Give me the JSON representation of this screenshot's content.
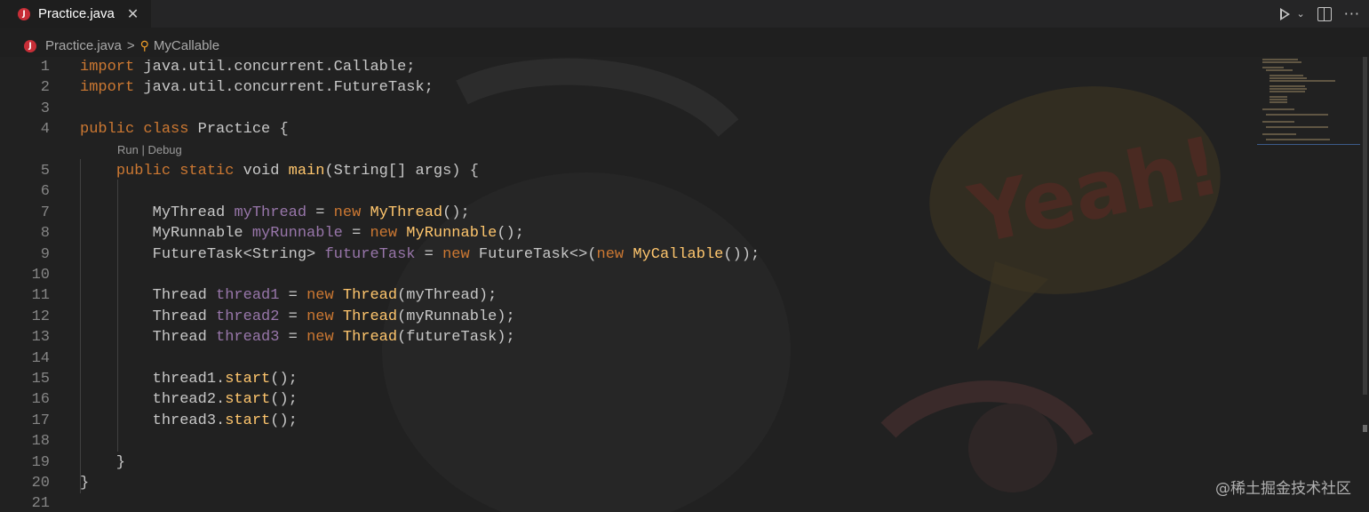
{
  "tab": {
    "icon_letter": "J",
    "label": "Practice.java",
    "close": "✕"
  },
  "breadcrumb": {
    "file": "Practice.java",
    "separator": ">",
    "symbol": "MyCallable"
  },
  "codelens": "Run | Debug",
  "watermark": "@稀土掘金技术社区",
  "lines": [
    {
      "n": "1",
      "segs": [
        [
          "kw",
          "import"
        ],
        [
          "t",
          " java.util.concurrent.Callable;"
        ]
      ]
    },
    {
      "n": "2",
      "segs": [
        [
          "kw",
          "import"
        ],
        [
          "t",
          " java.util.concurrent.FutureTask;"
        ]
      ]
    },
    {
      "n": "3",
      "segs": []
    },
    {
      "n": "4",
      "segs": [
        [
          "kw",
          "public class"
        ],
        [
          "t",
          " Practice {"
        ]
      ]
    },
    {
      "n": "5",
      "segs": [
        [
          "t",
          "    "
        ],
        [
          "kw",
          "public static"
        ],
        [
          "t",
          " void "
        ],
        [
          "fn",
          "main"
        ],
        [
          "t",
          "(String[] args) {"
        ]
      ]
    },
    {
      "n": "6",
      "segs": []
    },
    {
      "n": "7",
      "segs": [
        [
          "t",
          "        MyThread "
        ],
        [
          "var",
          "myThread"
        ],
        [
          "t",
          " = "
        ],
        [
          "kw",
          "new"
        ],
        [
          "t",
          " "
        ],
        [
          "fn",
          "MyThread"
        ],
        [
          "t",
          "();"
        ]
      ]
    },
    {
      "n": "8",
      "segs": [
        [
          "t",
          "        MyRunnable "
        ],
        [
          "var",
          "myRunnable"
        ],
        [
          "t",
          " = "
        ],
        [
          "kw",
          "new"
        ],
        [
          "t",
          " "
        ],
        [
          "fn",
          "MyRunnable"
        ],
        [
          "t",
          "();"
        ]
      ]
    },
    {
      "n": "9",
      "segs": [
        [
          "t",
          "        FutureTask<String> "
        ],
        [
          "var",
          "futureTask"
        ],
        [
          "t",
          " = "
        ],
        [
          "kw",
          "new"
        ],
        [
          "t",
          " FutureTask<>("
        ],
        [
          "kw",
          "new"
        ],
        [
          "t",
          " "
        ],
        [
          "fn",
          "MyCallable"
        ],
        [
          "t",
          "());"
        ]
      ]
    },
    {
      "n": "10",
      "segs": []
    },
    {
      "n": "11",
      "segs": [
        [
          "t",
          "        Thread "
        ],
        [
          "var",
          "thread1"
        ],
        [
          "t",
          " = "
        ],
        [
          "kw",
          "new"
        ],
        [
          "t",
          " "
        ],
        [
          "fn",
          "Thread"
        ],
        [
          "t",
          "(myThread);"
        ]
      ]
    },
    {
      "n": "12",
      "segs": [
        [
          "t",
          "        Thread "
        ],
        [
          "var",
          "thread2"
        ],
        [
          "t",
          " = "
        ],
        [
          "kw",
          "new"
        ],
        [
          "t",
          " "
        ],
        [
          "fn",
          "Thread"
        ],
        [
          "t",
          "(myRunnable);"
        ]
      ]
    },
    {
      "n": "13",
      "segs": [
        [
          "t",
          "        Thread "
        ],
        [
          "var",
          "thread3"
        ],
        [
          "t",
          " = "
        ],
        [
          "kw",
          "new"
        ],
        [
          "t",
          " "
        ],
        [
          "fn",
          "Thread"
        ],
        [
          "t",
          "(futureTask);"
        ]
      ]
    },
    {
      "n": "14",
      "segs": []
    },
    {
      "n": "15",
      "segs": [
        [
          "t",
          "        thread1."
        ],
        [
          "fn",
          "start"
        ],
        [
          "t",
          "();"
        ]
      ]
    },
    {
      "n": "16",
      "segs": [
        [
          "t",
          "        thread2."
        ],
        [
          "fn",
          "start"
        ],
        [
          "t",
          "();"
        ]
      ]
    },
    {
      "n": "17",
      "segs": [
        [
          "t",
          "        thread3."
        ],
        [
          "fn",
          "start"
        ],
        [
          "t",
          "();"
        ]
      ]
    },
    {
      "n": "18",
      "segs": []
    },
    {
      "n": "19",
      "segs": [
        [
          "t",
          "    }"
        ]
      ]
    },
    {
      "n": "20",
      "segs": [
        [
          "t",
          "}"
        ]
      ]
    },
    {
      "n": "21",
      "segs": []
    }
  ],
  "icons": {
    "run": "run-icon",
    "run_menu": "chevron-down-icon",
    "split": "split-editor-icon",
    "more": "more-actions-icon",
    "file_type": "java-file-icon",
    "symbol": "class-symbol-icon"
  }
}
